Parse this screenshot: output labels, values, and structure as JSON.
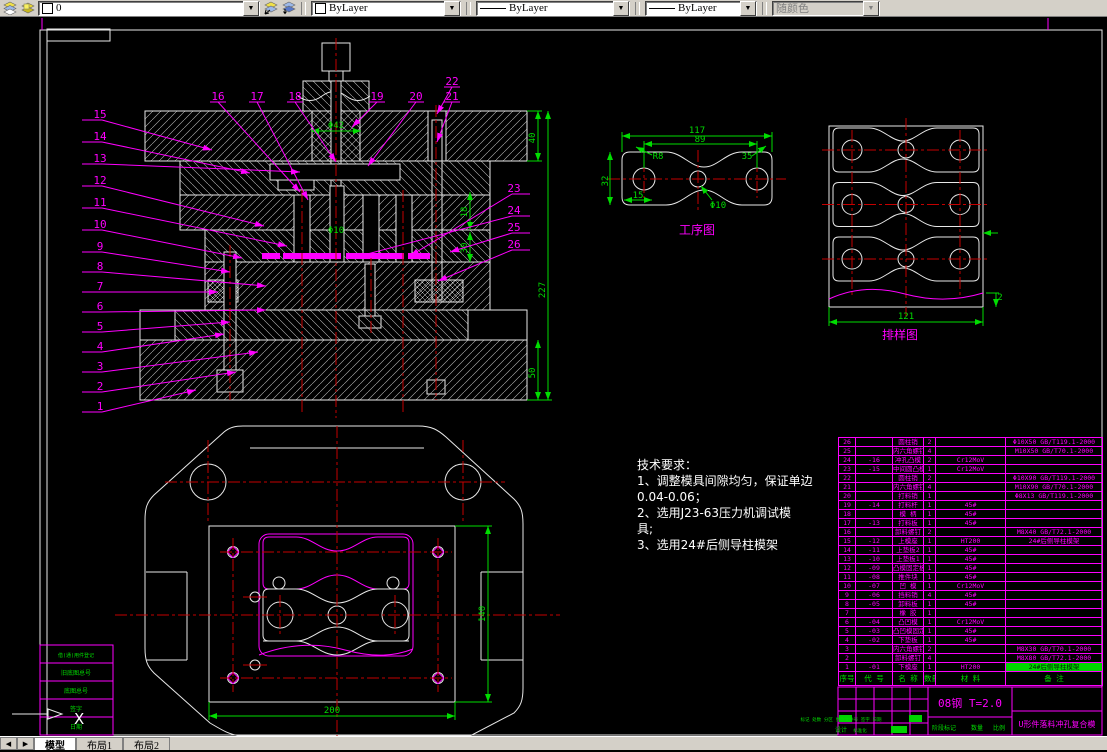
{
  "toolbar": {
    "layer": {
      "value": "0"
    },
    "color": {
      "value": "ByLayer"
    },
    "linetype": {
      "value": "ByLayer"
    },
    "lineweight": {
      "value": "ByLayer"
    },
    "plot_style": {
      "value": "随颜色"
    }
  },
  "section": {
    "callouts_left": [
      "15",
      "14",
      "13",
      "12",
      "11",
      "10",
      "9",
      "8",
      "7",
      "6",
      "5",
      "4",
      "3",
      "2",
      "1"
    ],
    "callouts_top": [
      "16",
      "17",
      "18",
      "19",
      "20",
      "21",
      "22"
    ],
    "callouts_right": [
      "23",
      "24",
      "25",
      "26"
    ],
    "dims": {
      "phi42": "Φ42",
      "h40": "40",
      "phi10": "Φ10",
      "v18": "18",
      "v30": "30",
      "h227": "227",
      "h50": "50"
    }
  },
  "process_view": {
    "label": "工序图",
    "dims": {
      "w117": "117",
      "w89": "89",
      "r8": "R8",
      "w35": "35",
      "w15": "15",
      "phi10": "Φ10",
      "h32": "32"
    }
  },
  "strip_view": {
    "label": "排样图",
    "dims": {
      "w121": "121",
      "t2": "2"
    }
  },
  "plan_view": {
    "dims": {
      "w200": "200",
      "h140": "140"
    }
  },
  "tech_requirements": {
    "lines": [
      "技术要求：",
      "1、调整模具间隙均匀，保证单边",
      "0.04-0.06；",
      "2、选用J23-63压力机调试模",
      "具;",
      "3、选用24#后侧导柱模架"
    ]
  },
  "bom": {
    "headers": [
      "序号",
      "代 号",
      "名  称",
      "数量",
      "材  料",
      "备  注"
    ],
    "rows": [
      {
        "seq": "26",
        "code": "",
        "name": "圆柱销",
        "qty": "2",
        "mat": "",
        "note": "Φ10X50 GB/T119.1-2000"
      },
      {
        "seq": "25",
        "code": "",
        "name": "内六角螺钉",
        "qty": "4",
        "mat": "",
        "note": "M10X50 GB/T70.1-2000"
      },
      {
        "seq": "24",
        "code": "-16",
        "name": "冲孔凸模",
        "qty": "2",
        "mat": "Cr12MoV",
        "note": ""
      },
      {
        "seq": "23",
        "code": "-15",
        "name": "中间圆凸模",
        "qty": "1",
        "mat": "Cr12MoV",
        "note": ""
      },
      {
        "seq": "22",
        "code": "",
        "name": "圆柱销",
        "qty": "2",
        "mat": "",
        "note": "Φ10X90 GB/T119.1-2000"
      },
      {
        "seq": "21",
        "code": "",
        "name": "内六角螺钉",
        "qty": "4",
        "mat": "",
        "note": "M10X90 GB/T70.1-2000"
      },
      {
        "seq": "20",
        "code": "",
        "name": "打料销",
        "qty": "1",
        "mat": "",
        "note": "Φ8X13 GB/T119.1-2000"
      },
      {
        "seq": "19",
        "code": "-14",
        "name": "打料杆",
        "qty": "1",
        "mat": "45#",
        "note": ""
      },
      {
        "seq": "18",
        "code": "",
        "name": "模  柄",
        "qty": "1",
        "mat": "45#",
        "note": ""
      },
      {
        "seq": "17",
        "code": "-13",
        "name": "打料板",
        "qty": "1",
        "mat": "45#",
        "note": ""
      },
      {
        "seq": "16",
        "code": "",
        "name": "卸料螺钉",
        "qty": "2",
        "mat": "",
        "note": "M8X40 GB/T72.1-2000"
      },
      {
        "seq": "15",
        "code": "-12",
        "name": "上模座",
        "qty": "1",
        "mat": "HT200",
        "note": "24#后侧导柱模架"
      },
      {
        "seq": "14",
        "code": "-11",
        "name": "上垫板2",
        "qty": "1",
        "mat": "45#",
        "note": ""
      },
      {
        "seq": "13",
        "code": "-10",
        "name": "上垫板1",
        "qty": "1",
        "mat": "45#",
        "note": ""
      },
      {
        "seq": "12",
        "code": "-09",
        "name": "凸模固定板",
        "qty": "1",
        "mat": "45#",
        "note": ""
      },
      {
        "seq": "11",
        "code": "-08",
        "name": "推件块",
        "qty": "1",
        "mat": "45#",
        "note": ""
      },
      {
        "seq": "10",
        "code": "-07",
        "name": "凹  模",
        "qty": "1",
        "mat": "Cr12MoV",
        "note": ""
      },
      {
        "seq": "9",
        "code": "-06",
        "name": "挡料销",
        "qty": "4",
        "mat": "45#",
        "note": ""
      },
      {
        "seq": "8",
        "code": "-05",
        "name": "卸料板",
        "qty": "1",
        "mat": "45#",
        "note": ""
      },
      {
        "seq": "7",
        "code": "",
        "name": "橡  胶",
        "qty": "1",
        "mat": "",
        "note": ""
      },
      {
        "seq": "6",
        "code": "-04",
        "name": "凸凹模",
        "qty": "1",
        "mat": "Cr12MoV",
        "note": ""
      },
      {
        "seq": "5",
        "code": "-03",
        "name": "凸凹模固定板",
        "qty": "1",
        "mat": "45#",
        "note": ""
      },
      {
        "seq": "4",
        "code": "-02",
        "name": "下垫板",
        "qty": "1",
        "mat": "45#",
        "note": ""
      },
      {
        "seq": "3",
        "code": "",
        "name": "内六角螺钉",
        "qty": "2",
        "mat": "",
        "note": "M8X30 GB/T70.1-2000"
      },
      {
        "seq": "2",
        "code": "",
        "name": "卸料螺钉",
        "qty": "4",
        "mat": "",
        "note": "M8X80 GB/T72.1-2000"
      },
      {
        "seq": "1",
        "code": "-01",
        "name": "下模座",
        "qty": "1",
        "mat": "HT200",
        "note": "24#后侧导柱模架",
        "hl": true
      }
    ]
  },
  "title_block": {
    "material_spec": "08钢  T=2.0",
    "drawing_title": "U形件落料冲孔复合模",
    "change_row": "标记 处数 分区 更改文件号 签字 日期",
    "designer": "设计",
    "standardization": "标准化",
    "stage": "阶段标记",
    "qty": "数量",
    "scale": "比例"
  },
  "left_margin": {
    "labels": [
      "借(通)用件登记",
      "旧底图总号",
      "底图总号",
      "签字",
      "日期"
    ]
  },
  "ucs": {
    "x_label": "X"
  },
  "tabs": {
    "model": "模型",
    "layout1": "布局1",
    "layout2": "布局2"
  }
}
